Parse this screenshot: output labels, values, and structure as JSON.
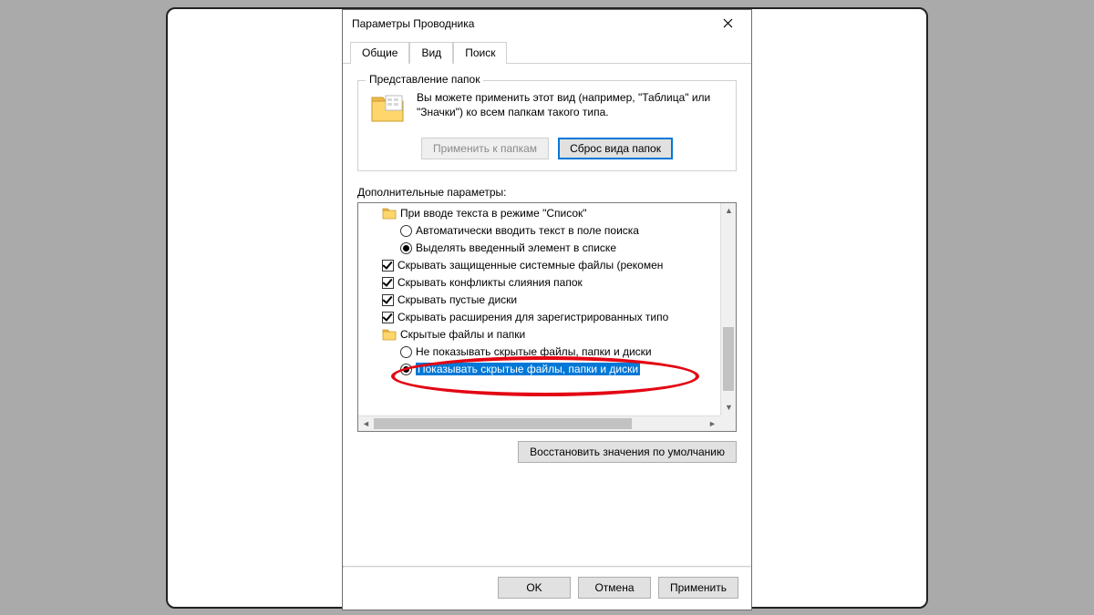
{
  "window": {
    "title": "Параметры Проводника"
  },
  "tabs": {
    "general": "Общие",
    "view": "Вид",
    "search": "Поиск"
  },
  "folderviews": {
    "legend": "Представление папок",
    "text": "Вы можете применить этот вид (например, \"Таблица\" или \"Значки\") ко всем папкам такого типа.",
    "apply_btn": "Применить к папкам",
    "reset_btn": "Сброс вида папок"
  },
  "advanced": {
    "label": "Дополнительные параметры:",
    "items": [
      {
        "kind": "folder",
        "indent": 1,
        "label": "При вводе текста в режиме \"Список\""
      },
      {
        "kind": "radio",
        "indent": 2,
        "checked": false,
        "label": "Автоматически вводить текст в поле поиска"
      },
      {
        "kind": "radio",
        "indent": 2,
        "checked": true,
        "label": "Выделять введенный элемент в списке"
      },
      {
        "kind": "check",
        "indent": 1,
        "checked": true,
        "label": "Скрывать защищенные системные файлы (рекомен"
      },
      {
        "kind": "check",
        "indent": 1,
        "checked": true,
        "label": "Скрывать конфликты слияния папок"
      },
      {
        "kind": "check",
        "indent": 1,
        "checked": true,
        "label": "Скрывать пустые диски"
      },
      {
        "kind": "check",
        "indent": 1,
        "checked": true,
        "label": "Скрывать расширения для зарегистрированных типо"
      },
      {
        "kind": "folder",
        "indent": 1,
        "label": "Скрытые файлы и папки"
      },
      {
        "kind": "radio",
        "indent": 2,
        "checked": false,
        "label": "Не показывать скрытые файлы, папки и диски"
      },
      {
        "kind": "radio",
        "indent": 2,
        "checked": true,
        "selected": true,
        "label": "Показывать скрытые файлы, папки и диски"
      }
    ],
    "restore_btn": "Восстановить значения по умолчанию"
  },
  "buttons": {
    "ok": "OK",
    "cancel": "Отмена",
    "apply": "Применить"
  }
}
